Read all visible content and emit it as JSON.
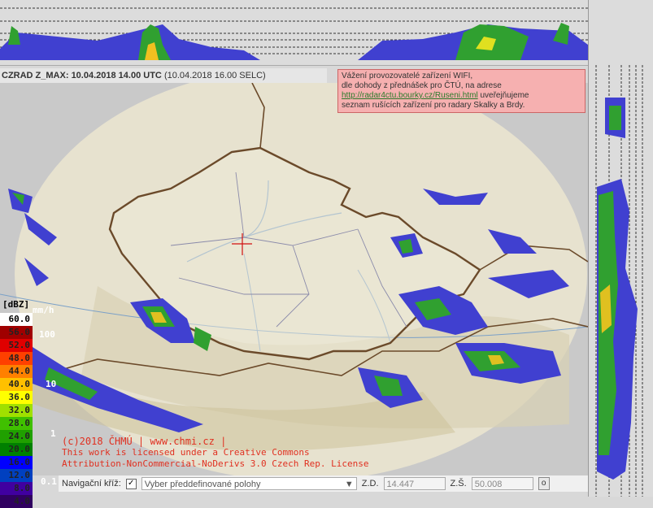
{
  "title": {
    "product": "CZRAD Z_MAX:",
    "datetime_utc": "10.04.2018 14.00 UTC",
    "datetime_local": "(10.04.2018 16.00 SELC)"
  },
  "notice": {
    "line1": "Vážení provozovatelé zařízení WIFI,",
    "line2": "dle dohody z přednášek pro ČTÚ, na adrese",
    "link": "http://radar4ctu.bourky.cz/Ruseni.html",
    "line3_tail": " uveřejňujeme",
    "line4": "seznam rušících zařízení pro radary Skalky a Brdy."
  },
  "legend": {
    "unit": "[dBZ]",
    "rain_unit": "mm/h",
    "levels": [
      {
        "value": "60.0",
        "color": "#ffffff"
      },
      {
        "value": "56.0",
        "color": "#a00000"
      },
      {
        "value": "52.0",
        "color": "#e00000"
      },
      {
        "value": "48.0",
        "color": "#ff4000"
      },
      {
        "value": "44.0",
        "color": "#ff8000"
      },
      {
        "value": "40.0",
        "color": "#ffc000"
      },
      {
        "value": "36.0",
        "color": "#ffff00"
      },
      {
        "value": "32.0",
        "color": "#a0e000"
      },
      {
        "value": "28.0",
        "color": "#40c000"
      },
      {
        "value": "24.0",
        "color": "#20a000"
      },
      {
        "value": "20.0",
        "color": "#008000"
      },
      {
        "value": "16.0",
        "color": "#0000ff"
      },
      {
        "value": "12.0",
        "color": "#0040c0"
      },
      {
        "value": "8.0",
        "color": "#4000a0"
      },
      {
        "value": "4.0",
        "color": "#300060"
      }
    ],
    "rain_marks": [
      "100",
      "10",
      "1",
      "0.1"
    ]
  },
  "copyright": {
    "line1": "(c)2018 ČHMÚ | www.chmi.cz |",
    "line2": "This work is licensed under a Creative Commons",
    "line3": "Attribution-NonCommercial-NoDerivs 3.0 Czech Rep. License"
  },
  "bottom": {
    "nav_label": "Navigační kříž:",
    "nav_checked": "✓",
    "select_placeholder": "Vyber předdefinované polohy",
    "lon_label": "Z.D.",
    "lon_value": "14.447",
    "lat_label": "Z.Š.",
    "lat_value": "50.008",
    "ok_label": "o"
  },
  "colors": {
    "border": "#6b4a2a",
    "radar_range_fill": "#e9e7dc",
    "notice_bg": "#f6b0b0"
  }
}
